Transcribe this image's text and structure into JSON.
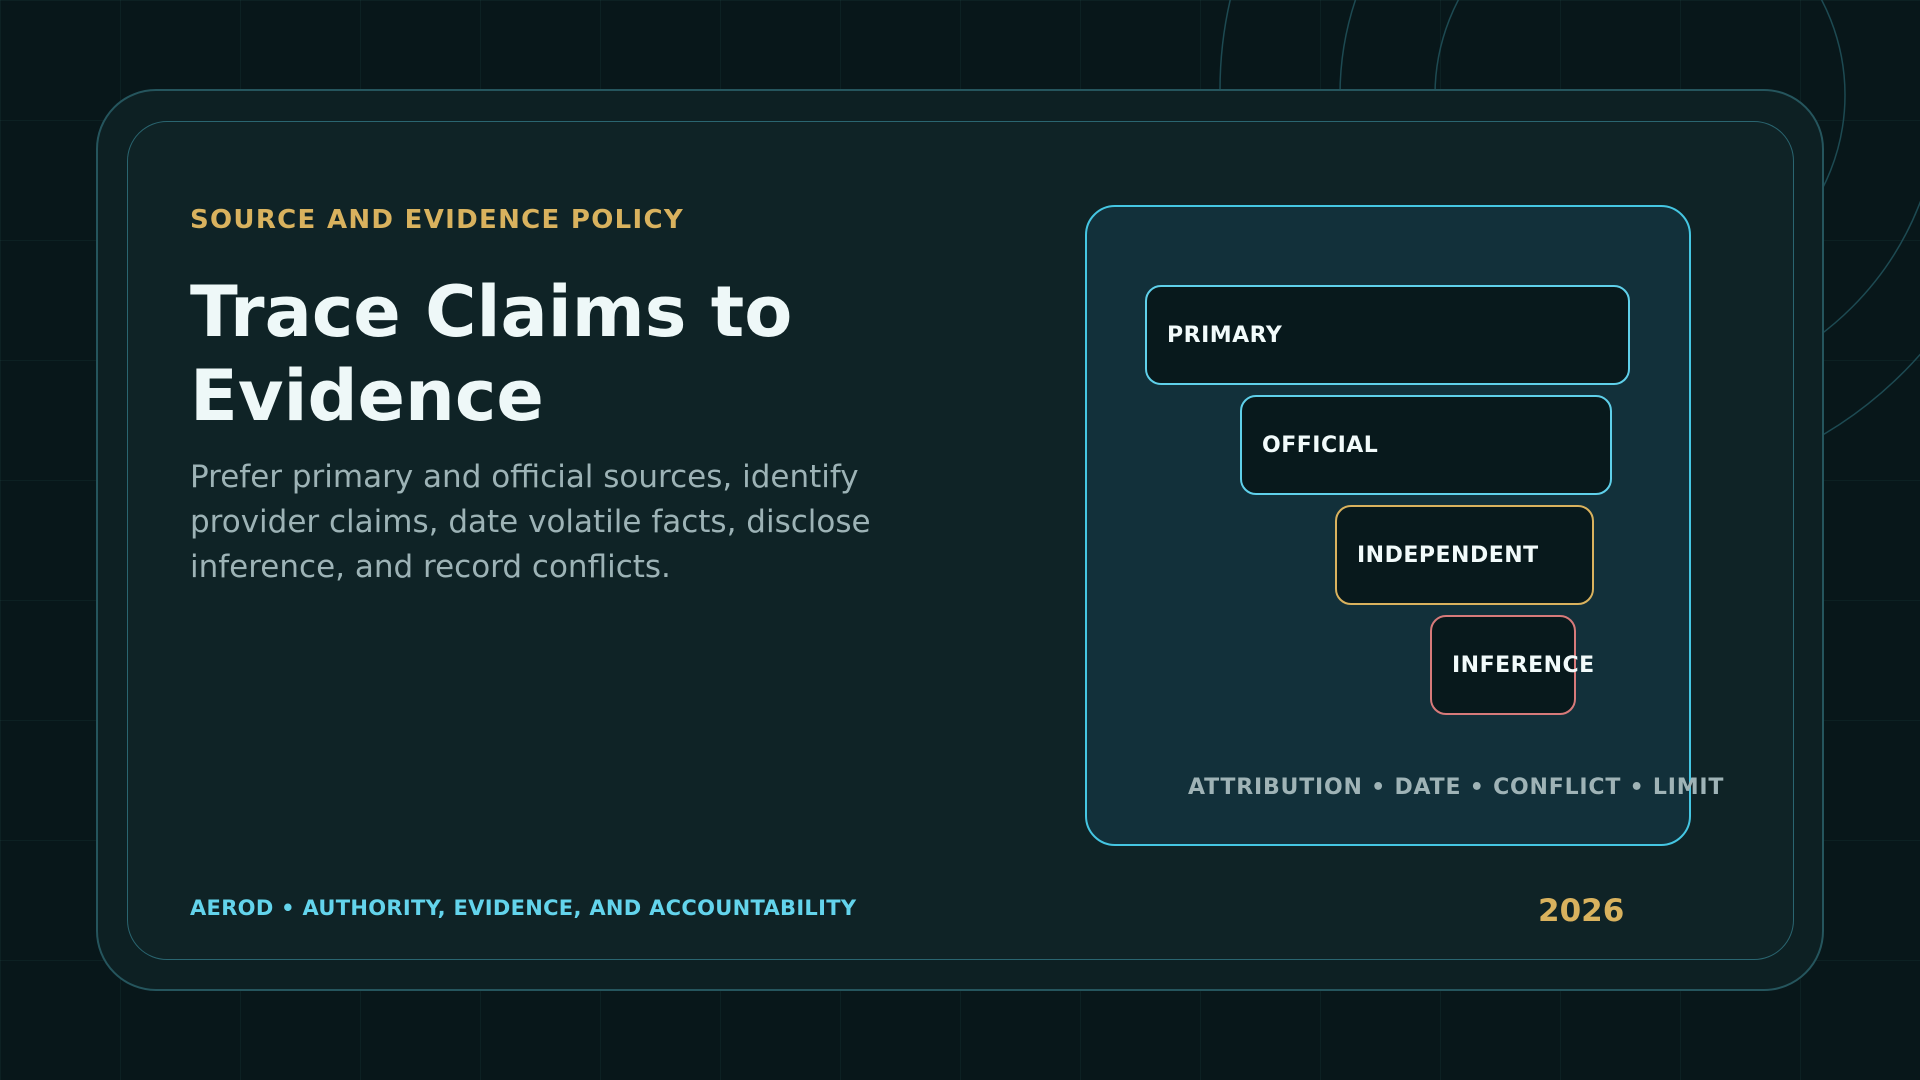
{
  "slide": {
    "kicker": "SOURCE AND EVIDENCE POLICY",
    "title": "Trace Claims to Evidence",
    "description": "Prefer primary and official sources, identify provider claims, date volatile facts, disclose inference, and record conflicts.",
    "footer_left": "AEROD • AUTHORITY, EVIDENCE, AND ACCOUNTABILITY",
    "footer_year": "2026"
  },
  "diagram": {
    "tiers": [
      {
        "label": "PRIMARY",
        "color": "#5fd0ea"
      },
      {
        "label": "OFFICIAL",
        "color": "#5fd0ea"
      },
      {
        "label": "INDEPENDENT",
        "color": "#d9b25e"
      },
      {
        "label": "INFERENCE",
        "color": "#d77a7a"
      }
    ],
    "caption": "ATTRIBUTION • DATE • CONFLICT • LIMIT"
  },
  "colors": {
    "background": "#08171a",
    "accent_cyan": "#45c6e2",
    "accent_gold": "#d9b25e",
    "accent_red": "#d77a7a"
  }
}
